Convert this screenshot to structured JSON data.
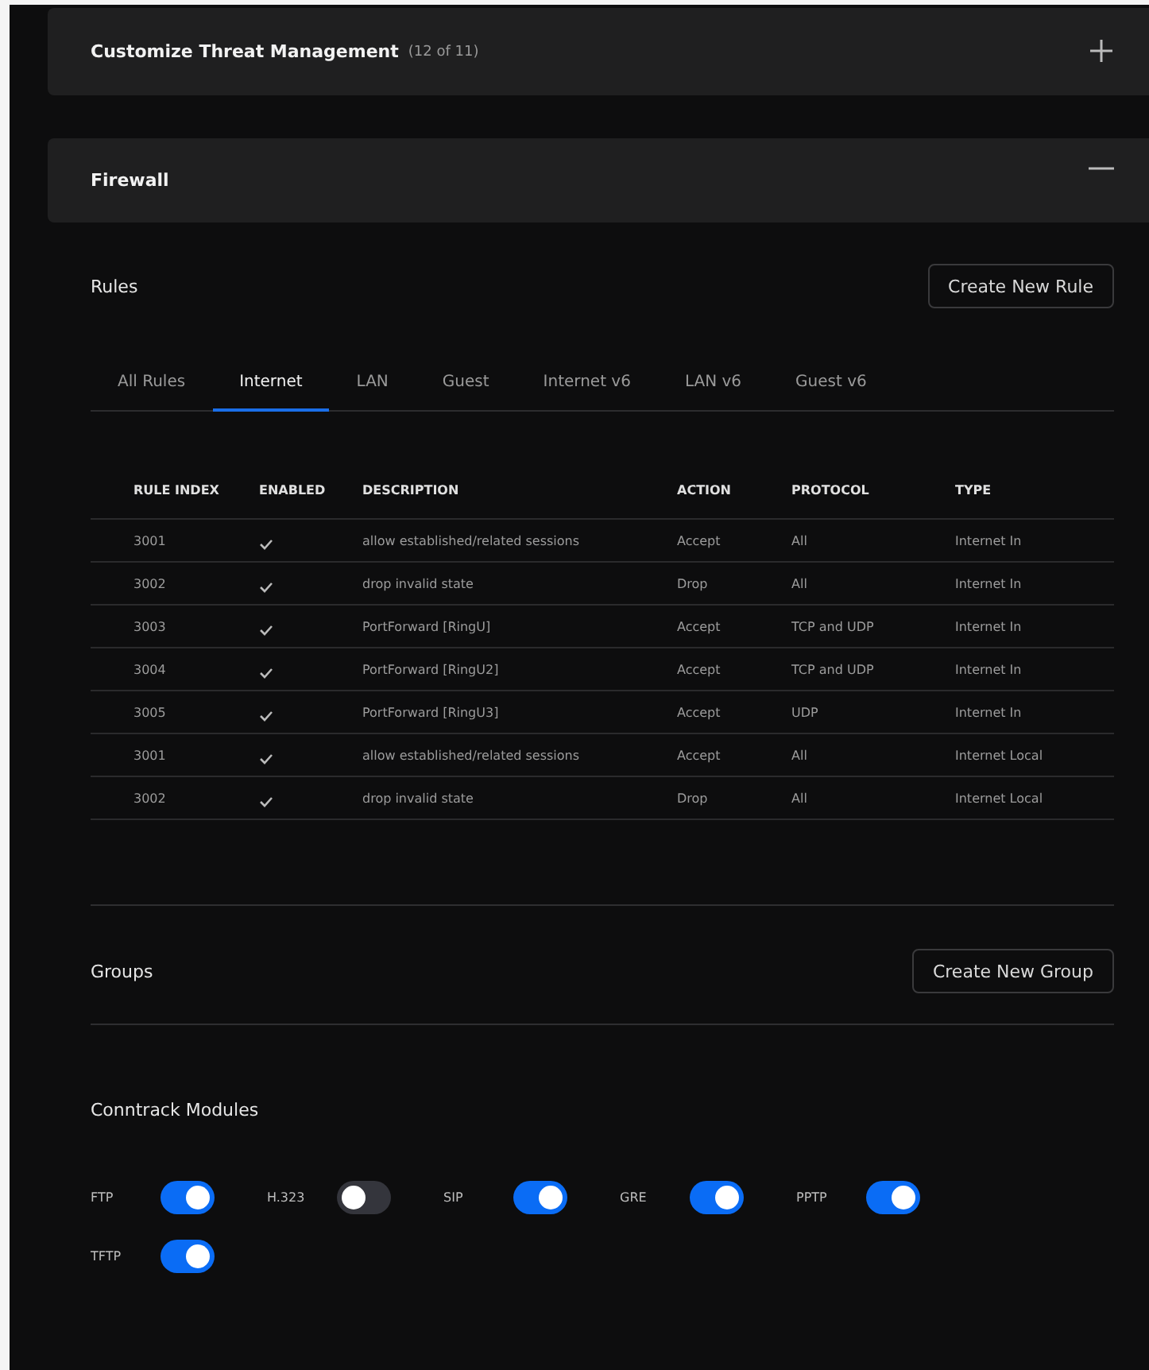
{
  "sections": [
    {
      "title": "Customize Threat Management",
      "count": "(12 of 11)",
      "expanded": false
    },
    {
      "title": "Firewall",
      "expanded": true
    }
  ],
  "rules": {
    "title": "Rules",
    "button": "Create New Rule",
    "tabs": [
      {
        "label": "All Rules",
        "selected": false
      },
      {
        "label": "Internet",
        "selected": true
      },
      {
        "label": "LAN",
        "selected": false
      },
      {
        "label": "Guest",
        "selected": false
      },
      {
        "label": "Internet v6",
        "selected": false
      },
      {
        "label": "LAN v6",
        "selected": false
      },
      {
        "label": "Guest v6",
        "selected": false
      }
    ],
    "columns": [
      "RULE INDEX",
      "ENABLED",
      "DESCRIPTION",
      "ACTION",
      "PROTOCOL",
      "TYPE"
    ],
    "rows": [
      {
        "index": "3001",
        "enabled": true,
        "description": "allow established/related sessions",
        "action": "Accept",
        "protocol": "All",
        "type": "Internet In"
      },
      {
        "index": "3002",
        "enabled": true,
        "description": "drop invalid state",
        "action": "Drop",
        "protocol": "All",
        "type": "Internet In"
      },
      {
        "index": "3003",
        "enabled": true,
        "description": "PortForward [RingU]",
        "action": "Accept",
        "protocol": "TCP and UDP",
        "type": "Internet In"
      },
      {
        "index": "3004",
        "enabled": true,
        "description": "PortForward [RingU2]",
        "action": "Accept",
        "protocol": "TCP and UDP",
        "type": "Internet In"
      },
      {
        "index": "3005",
        "enabled": true,
        "description": "PortForward [RingU3]",
        "action": "Accept",
        "protocol": "UDP",
        "type": "Internet In"
      },
      {
        "index": "3001",
        "enabled": true,
        "description": "allow established/related sessions",
        "action": "Accept",
        "protocol": "All",
        "type": "Internet Local"
      },
      {
        "index": "3002",
        "enabled": true,
        "description": "drop invalid state",
        "action": "Drop",
        "protocol": "All",
        "type": "Internet Local"
      }
    ]
  },
  "groups": {
    "title": "Groups",
    "button": "Create New Group"
  },
  "conntrack": {
    "title": "Conntrack Modules",
    "modules": [
      {
        "label": "FTP",
        "on": true
      },
      {
        "label": "H.323",
        "on": false
      },
      {
        "label": "SIP",
        "on": true
      },
      {
        "label": "GRE",
        "on": true
      },
      {
        "label": "PPTP",
        "on": true
      },
      {
        "label": "TFTP",
        "on": true
      }
    ]
  }
}
